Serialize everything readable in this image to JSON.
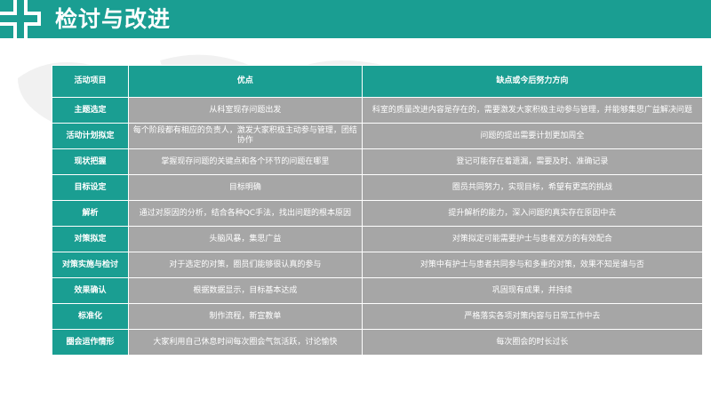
{
  "page": {
    "title": "检讨与改进",
    "accent_color": "#1a9e92",
    "cell_color": "#a6a6a6"
  },
  "table": {
    "headers": [
      "活动项目",
      "优点",
      "缺点或今后努力方向"
    ],
    "rows": [
      [
        "主题选定",
        "从科室现存问题出发",
        "科室的质量改进内容是存在的，需要激发大家积极主动参与管理，并能够集思广益解决问题"
      ],
      [
        "活动计划拟定",
        "每个阶段都有相应的负责人，激发大家积极主动参与管理，团结协作",
        "问题的提出需要计划更加周全"
      ],
      [
        "现状把握",
        "掌握现存问题的关键点和各个环节的问题在哪里",
        "登记可能存在着遗漏，需要及时、准确记录"
      ],
      [
        "目标设定",
        "目标明确",
        "圈员共同努力，实现目标，希望有更高的挑战"
      ],
      [
        "解析",
        "通过对原因的分析，结合各种QC手法，找出问题的根本原因",
        "提升解析的能力，深入问题的真实存在原因中去"
      ],
      [
        "对策拟定",
        "头脑风暴，集思广益",
        "对策拟定可能需要护士与患者双方的有效配合"
      ],
      [
        "对策实施与检讨",
        "对于选定的对策，圈员们能够很认真的参与",
        "对策中有护士与患者共同参与和多重的对策，效果不知是谁与否"
      ],
      [
        "效果确认",
        "根据数据显示，目标基本达成",
        "巩固现有成果，并持续"
      ],
      [
        "标准化",
        "制作流程，新宣教单",
        "严格落实各项对策内容与日常工作中去"
      ],
      [
        "圈会运作情形",
        "大家利用自己休息时间每次圈会气氛活跃，讨论愉快",
        "每次圈会的时长过长"
      ]
    ]
  }
}
